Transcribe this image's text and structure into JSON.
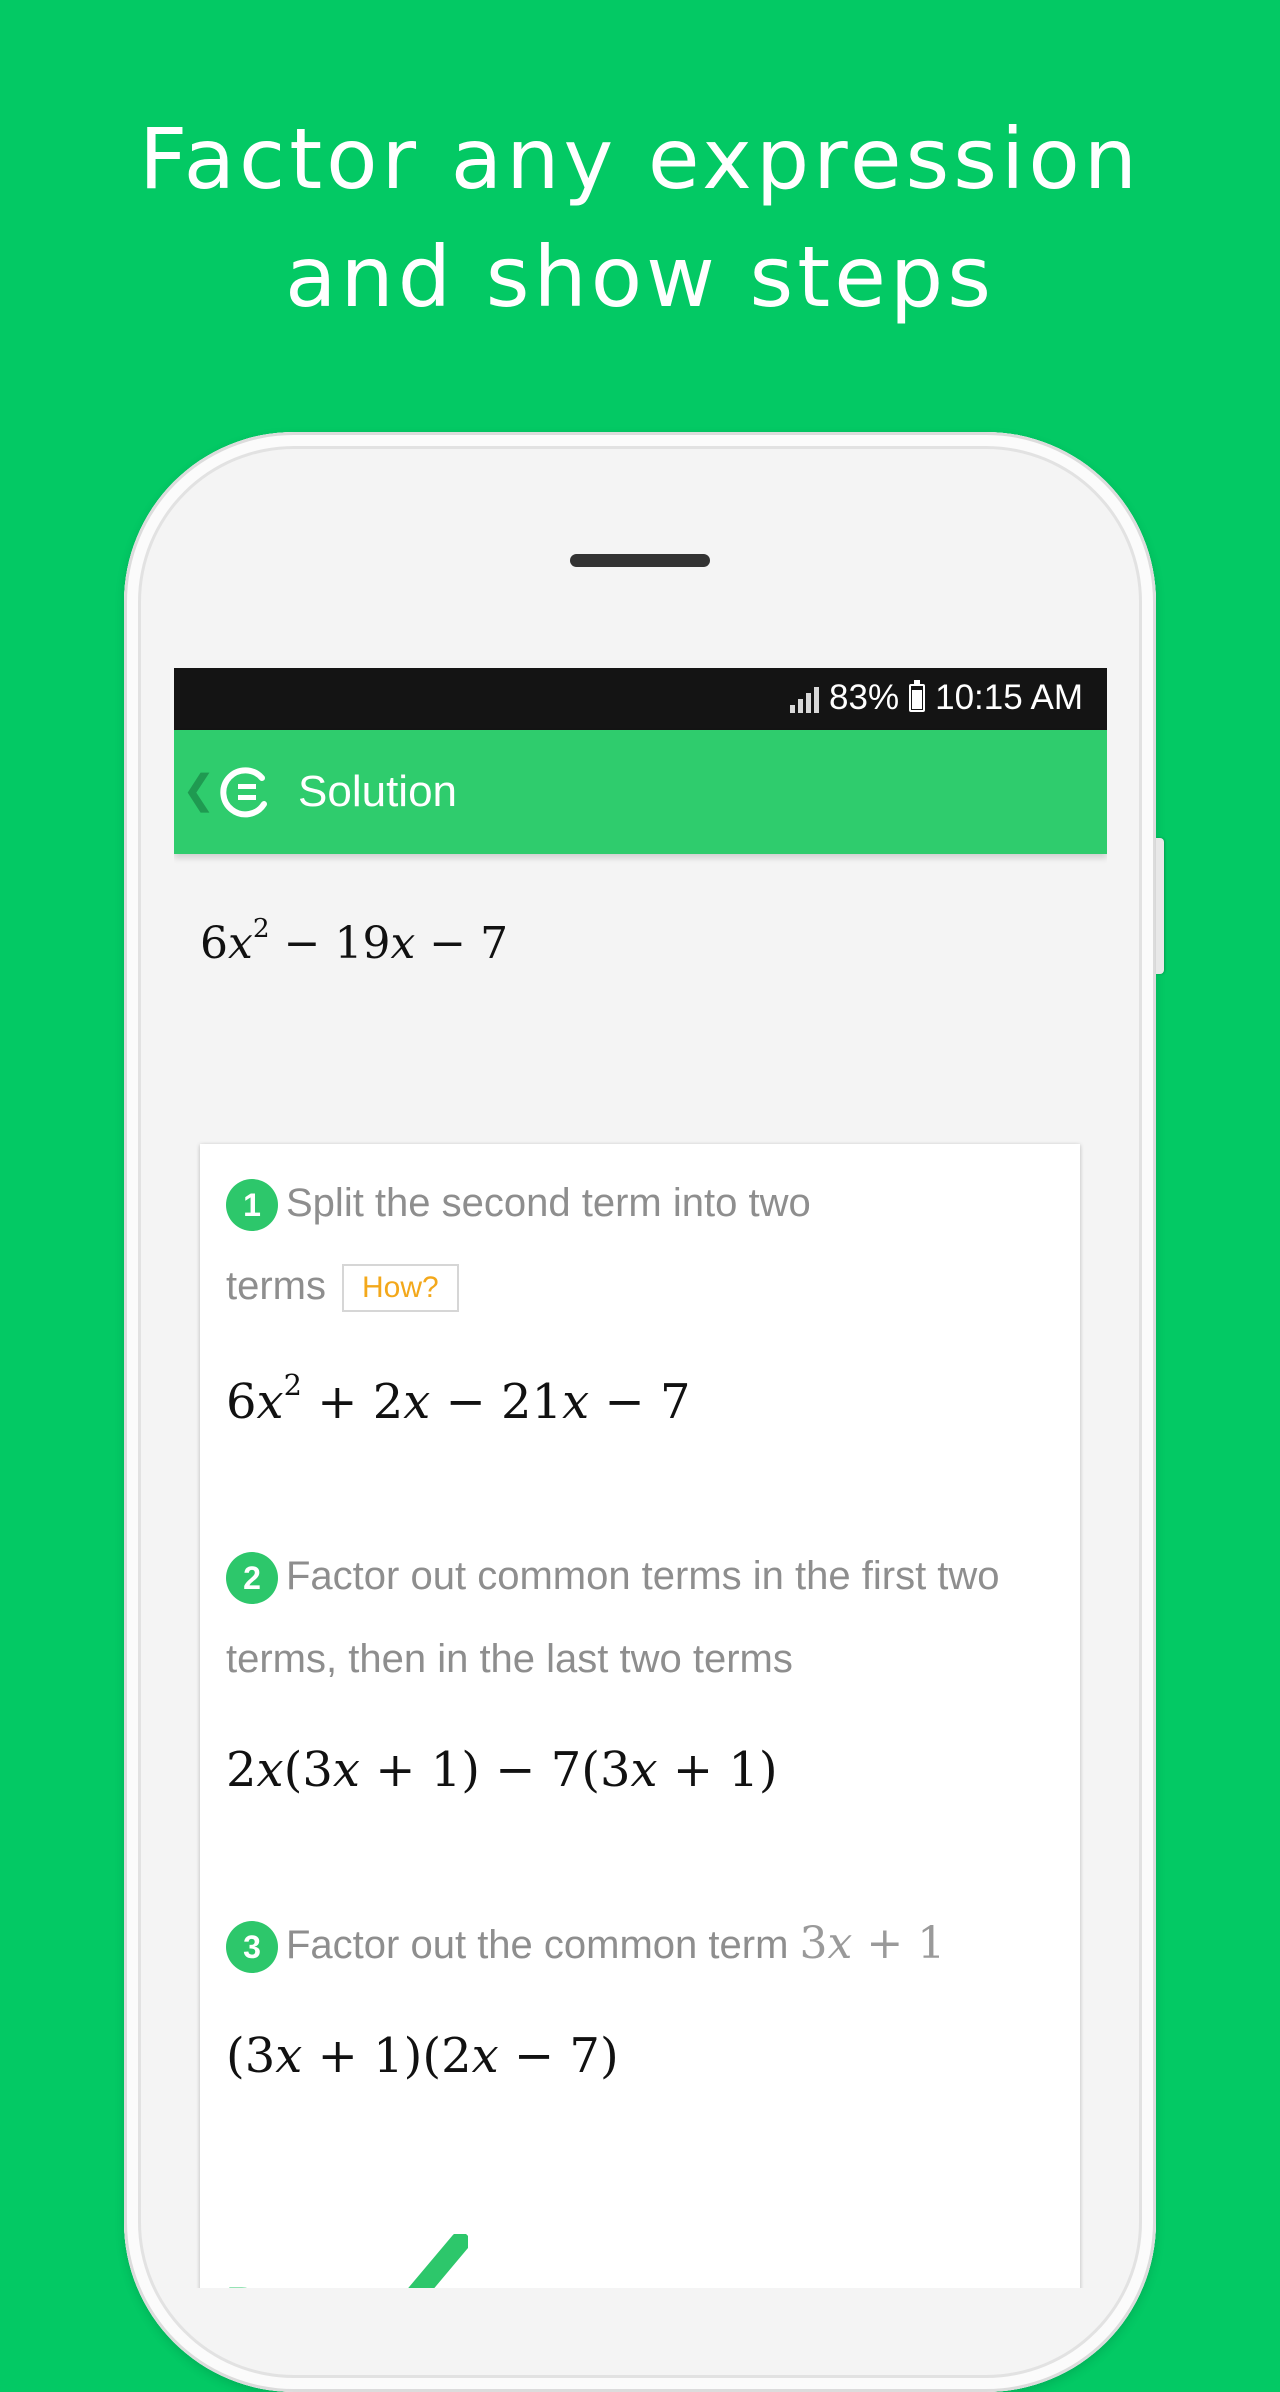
{
  "headline": {
    "line1": "Factor any expression",
    "line2": "and show steps"
  },
  "status_bar": {
    "battery": "83%",
    "time": "10:15 AM"
  },
  "app_bar": {
    "title": "Solution"
  },
  "problem": {
    "expression_parts": {
      "coef": "6",
      "var": "x",
      "exp": "2",
      "rest1": " − 19",
      "var2": "x",
      "rest2": " − 7"
    }
  },
  "steps": [
    {
      "number": "1",
      "text_line1": "Split the second term into two",
      "text_line2": "terms",
      "how_label": "How?",
      "math": {
        "a": "6",
        "b": "x",
        "c": "2",
        "d": " + 2",
        "e": "x",
        "f": " − 21",
        "g": "x",
        "h": " − 7"
      }
    },
    {
      "number": "2",
      "text_line1": "Factor out common terms in the first two",
      "text_line2": "terms, then in the last two terms",
      "math": {
        "a": "2",
        "b": "x",
        "c": "(3",
        "d": "x",
        "e": " + 1) − 7(3",
        "f": "x",
        "g": " + 1)"
      }
    },
    {
      "number": "3",
      "text_line1": "Factor out the common term",
      "inline_math": {
        "a": "3",
        "b": "x",
        "c": " + 1"
      },
      "math": {
        "a": "(3",
        "b": "x",
        "c": " + 1)(2",
        "d": "x",
        "e": " − 7)"
      }
    }
  ],
  "done_label": "Done",
  "colors": {
    "background": "#03c964",
    "app_bar": "#2fcc6d",
    "accent": "#2dc76b",
    "how_text": "#f3a81b"
  }
}
